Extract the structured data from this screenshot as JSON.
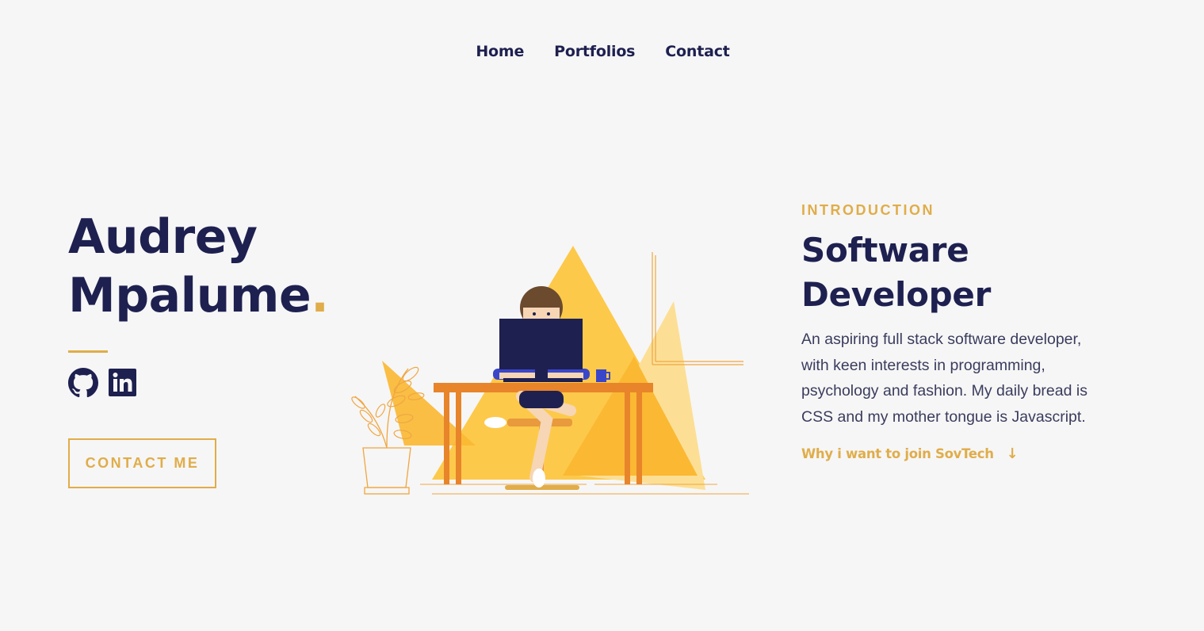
{
  "nav": {
    "items": [
      {
        "label": "Home"
      },
      {
        "label": "Portfolios"
      },
      {
        "label": "Contact"
      }
    ]
  },
  "hero": {
    "first_name": "Audrey",
    "last_name": "Mpalume",
    "name_dot": ".",
    "cta_label": "CONTACT ME",
    "social_icons": [
      "github-icon",
      "linkedin-icon"
    ]
  },
  "intro": {
    "label": "INTRODUCTION",
    "role_line1": "Software",
    "role_line2": "Developer",
    "description": "An aspiring full stack software developer, with keen interests in programming, psychology and fashion. My daily bread is CSS and my mother tongue is Javascript.",
    "link_label": "Why i want to join SovTech",
    "link_arrow": "↓"
  },
  "colors": {
    "accent": "#e0ad4a",
    "navy": "#1e2050",
    "background": "#f6f6f6"
  }
}
